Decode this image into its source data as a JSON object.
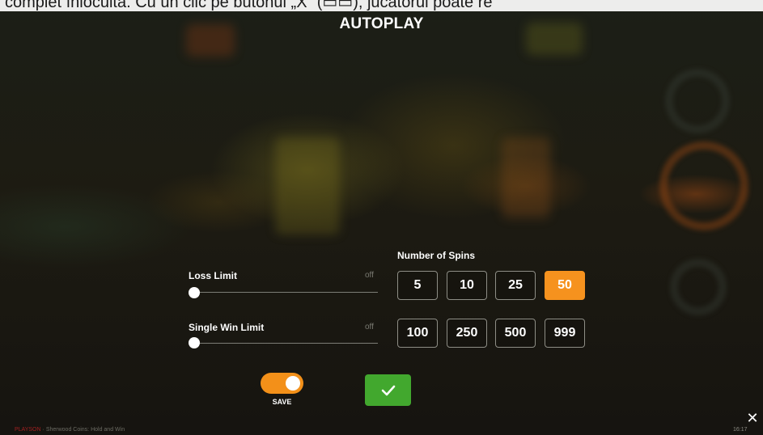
{
  "banner": {
    "text": "complet înlocuită. Cu un clic pe butonul „X” (▭▭), jucătorul poate re"
  },
  "dialog": {
    "title": "AUTOPLAY"
  },
  "loss_limit": {
    "label": "Loss Limit",
    "state": "off",
    "level": 0
  },
  "single_win_limit": {
    "label": "Single Win Limit",
    "state": "off",
    "level": 0
  },
  "spins": {
    "label": "Number of Spins",
    "options": [
      "5",
      "10",
      "25",
      "50",
      "100",
      "250",
      "500",
      "999"
    ],
    "selected": "50"
  },
  "save": {
    "label": "SAVE",
    "toggle_on": true
  },
  "confirm": {
    "icon": "checkmark-icon"
  },
  "close": {
    "glyph": "✕"
  },
  "footer": {
    "brand": "PLAYSON",
    "game": "Sherwood Coins: Hold and Win",
    "separator": "·",
    "clock": "16:17"
  },
  "colors": {
    "accent_orange": "#f6921e",
    "confirm_green": "#42a82e",
    "text_white": "#ffffff",
    "muted_gray": "#7a7a72"
  }
}
